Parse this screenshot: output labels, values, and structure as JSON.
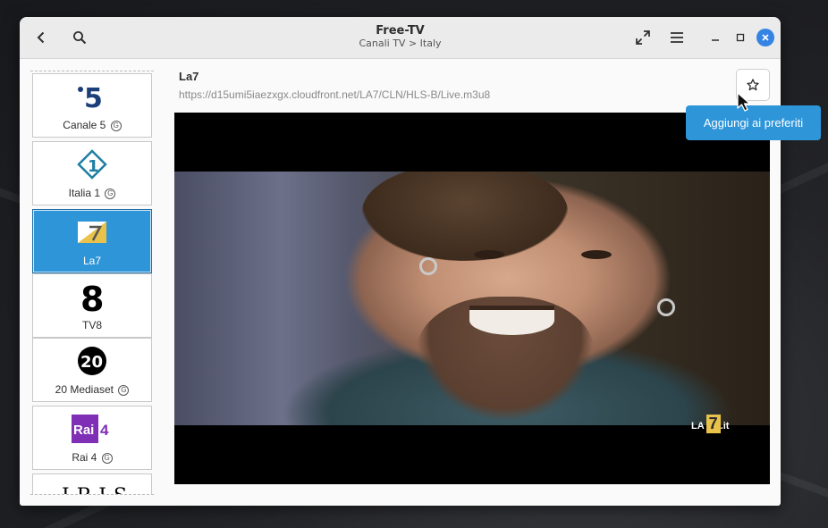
{
  "window": {
    "title": "Free-TV",
    "subtitle": "Canali TV > Italy"
  },
  "headerbar": {
    "back_icon": "chevron-left-icon",
    "search_icon": "search-icon",
    "fullscreen_icon": "expand-icon",
    "menu_icon": "hamburger-menu-icon",
    "minimize_icon": "minimize-icon",
    "maximize_icon": "maximize-icon",
    "close_icon": "close-icon"
  },
  "channels": [
    {
      "label": "Canale 5",
      "badge": "G",
      "logo_text": "5",
      "selected": false
    },
    {
      "label": "Italia 1",
      "badge": "G",
      "logo_text": "1",
      "selected": false
    },
    {
      "label": "La7",
      "badge": "",
      "logo_text": "",
      "selected": true
    },
    {
      "label": "TV8",
      "badge": "",
      "logo_text": "8",
      "selected": false
    },
    {
      "label": "20 Mediaset",
      "badge": "G",
      "logo_text": "20",
      "selected": false
    },
    {
      "label": "Rai 4",
      "badge": "G",
      "logo_text": "Rai",
      "logo_text_2": "4",
      "selected": false
    },
    {
      "label": "",
      "badge": "",
      "logo_text": "IRIS",
      "selected": false
    }
  ],
  "current": {
    "name": "La7",
    "url": "https://d15umi5iaezxgx.cloudfront.net/LA7/CLN/HLS-B/Live.m3u8"
  },
  "player": {
    "watermark_text": "LA",
    "watermark_badge": "7",
    "watermark_suffix": ".it"
  },
  "favorite": {
    "icon": "star-icon",
    "tooltip": "Aggiungi ai preferiti"
  },
  "colors": {
    "accent": "#2e95d9",
    "close_button": "#3584e4",
    "rai_purple": "#7e2fb5",
    "canale5_blue": "#1c3f7a",
    "italia1_teal": "#1e7ea3"
  }
}
